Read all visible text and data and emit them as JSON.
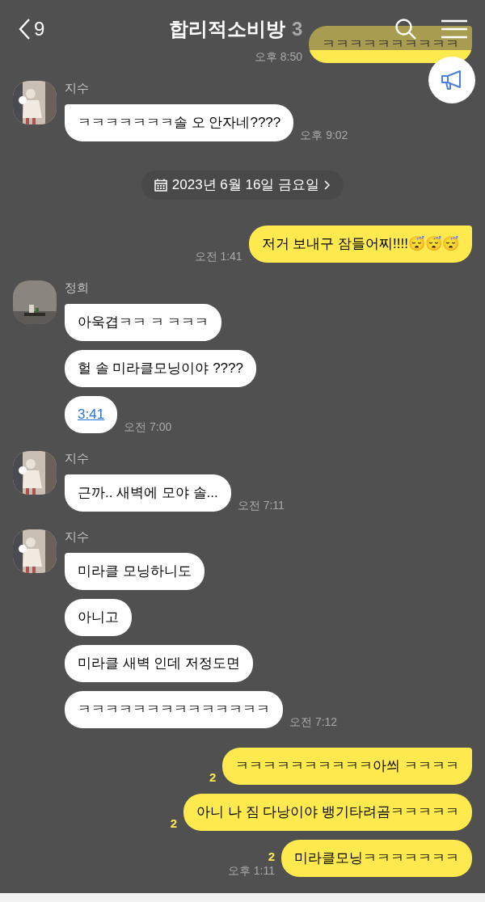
{
  "header": {
    "back_count": "9",
    "title": "합리적소비방",
    "member_count": "3"
  },
  "messages": [
    {
      "kind": "sent",
      "bubbles": [
        {
          "kind": "text",
          "text": "ㅋㅋㅋㅋㅋㅋㅋㅋㅋㅋ"
        }
      ],
      "time": "오후 8:50"
    },
    {
      "kind": "received",
      "sender": "지수",
      "bubbles": [
        {
          "kind": "text",
          "text": "ㅋㅋㅋㅋㅋㅋㅋ솔 오 안자네????"
        }
      ],
      "time": "오후 9:02"
    },
    {
      "kind": "date",
      "text": "2023년 6월 16일 금요일"
    },
    {
      "kind": "sent",
      "bubbles": [
        {
          "kind": "text",
          "text": "저거 보내구 잠들어찌!!!!😴😴😴"
        }
      ],
      "time": "오전 1:41"
    },
    {
      "kind": "received",
      "sender": "정희",
      "bubbles": [
        {
          "kind": "text",
          "text": "아욱겹ㅋㅋ ㅋ ㅋㅋㅋ"
        },
        {
          "kind": "text",
          "text": "헐 솔 미라클모닝이야 ????"
        },
        {
          "kind": "link",
          "text": "3:41"
        }
      ],
      "time": "오전 7:00"
    },
    {
      "kind": "received",
      "sender": "지수",
      "bubbles": [
        {
          "kind": "text",
          "text": "근까.. 새벽에 모야 솔..."
        }
      ],
      "time": "오전 7:11"
    },
    {
      "kind": "received",
      "sender": "지수",
      "bubbles": [
        {
          "kind": "text",
          "text": "미라클 모닝하니도"
        },
        {
          "kind": "text",
          "text": "아니고"
        },
        {
          "kind": "text",
          "text": "미라클 새벽 인데 저정도면"
        },
        {
          "kind": "text",
          "text": "ㅋㅋㅋㅋㅋㅋㅋㅋㅋㅋㅋㅋㅋㅋ"
        }
      ],
      "time": "오전 7:12"
    },
    {
      "kind": "sent",
      "bubbles": [
        {
          "kind": "text",
          "text": "ㅋㅋㅋㅋㅋㅋㅋㅋㅋㅋ아씌 ㅋㅋㅋㅋ",
          "unread": "2"
        },
        {
          "kind": "text",
          "text": "아니 나 짐 다낭이야 뱅기타려곰ㅋㅋㅋㅋㅋ",
          "unread": "2"
        },
        {
          "kind": "text",
          "text": "미라클모닝ㅋㅋㅋㅋㅋㅋㅋ",
          "unread": "2"
        }
      ],
      "time": "오후 1:11"
    }
  ]
}
